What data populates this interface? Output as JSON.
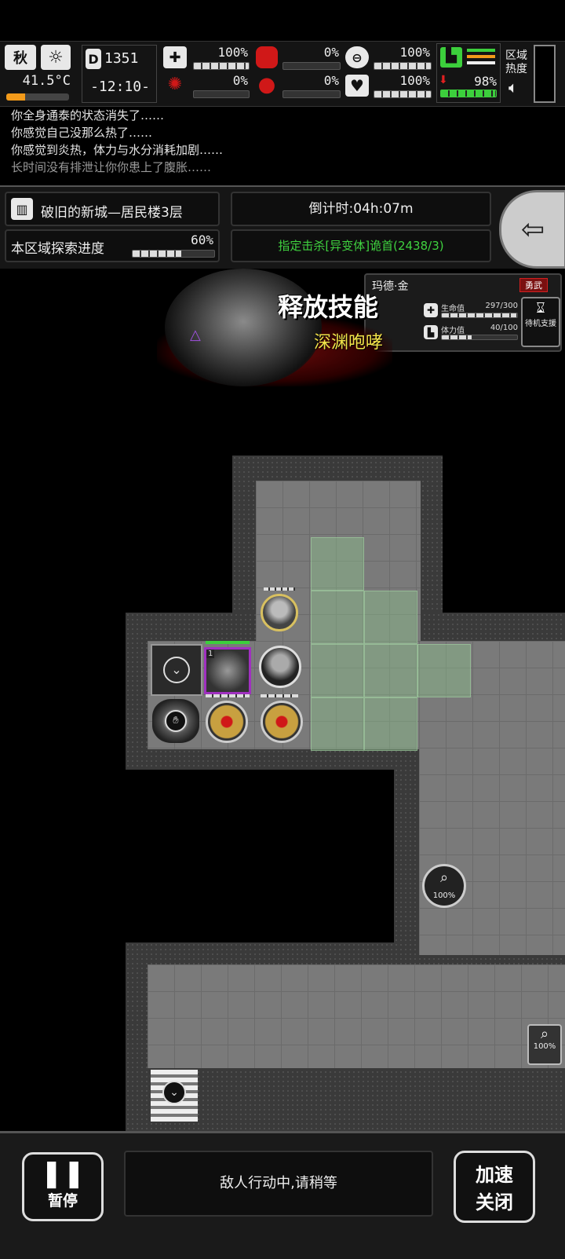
{
  "status": {
    "season": "秋",
    "temperature": "41.5°C",
    "day": "1351",
    "clock": "-12:10-",
    "health_pct": "100%",
    "stomach_pct": "0%",
    "fullness_pct": "100%",
    "infection_pct": "0%",
    "bleed_pct": "0%",
    "mood_pct": "100%",
    "stamina_pct": "98%",
    "zone_heat_label": "区域热度",
    "icons": [
      "leaf-icon",
      "sun-icon",
      "calendar-icon",
      "medkit-icon",
      "stomach-icon",
      "bottle-icon",
      "virus-icon",
      "blood-drop-icon",
      "heart-icon",
      "boot-icon",
      "speaker-icon"
    ]
  },
  "log": [
    "你全身通泰的状态消失了……",
    "你感觉自己没那么热了……",
    "你感觉到炎热，体力与水分消耗加剧……",
    "长时间没有排泄让你你患上了腹胀……"
  ],
  "location": {
    "name": "破旧的新城—居民楼3层",
    "countdown": "倒计时:04h:07m",
    "explore_label": "本区域探索进度",
    "explore_pct": "60%",
    "explore_value": 0.6,
    "mission": "指定击杀[异变体]诡首(2438/3)"
  },
  "skill_banner": {
    "title": "释放技能",
    "skill_name": "深渊咆哮"
  },
  "character": {
    "name": "玛德·金",
    "tag": "勇武",
    "hp_label": "生命值",
    "hp_value": "297/300",
    "stamina_label": "体力值",
    "stamina_value": "40/100",
    "support_label": "待机支援"
  },
  "map": {
    "search_pct_1": "100%",
    "search_pct_2": "100%",
    "enemy_level": "1"
  },
  "bottom": {
    "pause_label": "暂停",
    "message": "敌人行动中,请稍等",
    "speed_label_1": "加速",
    "speed_label_2": "关闭"
  },
  "colors": {
    "mission_green": "#3fd13f",
    "skill_yellow": "#f2e34a",
    "stamina_green": "#3ccf3c",
    "danger_red": "#d01818"
  }
}
